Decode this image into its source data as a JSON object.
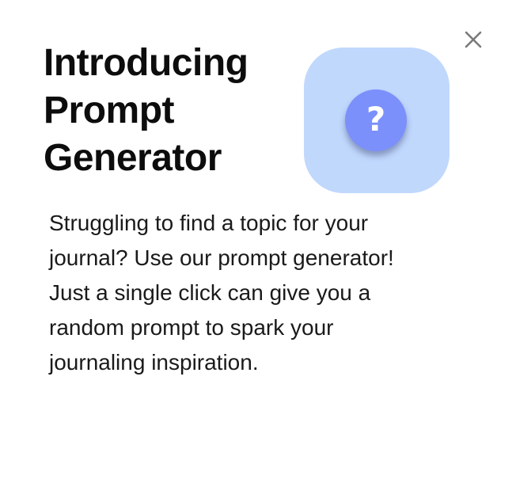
{
  "dialog": {
    "title_lines": [
      "Introducing",
      "Prompt",
      "Generator"
    ],
    "close_icon": "close-x-icon",
    "close_color": "#7a7a7a",
    "hero": {
      "icon": "question-mark-icon",
      "glyph": "?",
      "tile_color": "#c1d8fd",
      "circle_color": "#7b90fb"
    },
    "description_lines": [
      "Struggling to find a topic for your",
      "journal? Use our prompt generator!",
      "Just a single click can give you a",
      "random prompt to spark your",
      "journaling inspiration."
    ]
  }
}
